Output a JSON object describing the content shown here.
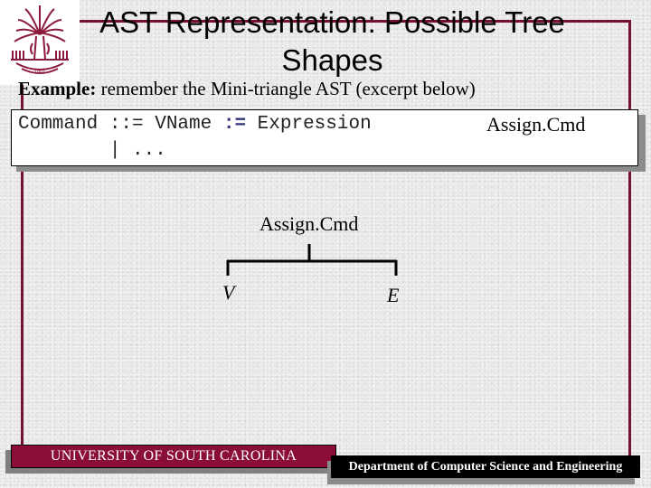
{
  "slide": {
    "title": "AST Representation: Possible Tree Shapes",
    "example_label": "Example:",
    "example_text": " remember the Mini-triangle AST (excerpt below)",
    "grammar": {
      "line1_lhs": "Command ::= VName ",
      "line1_op": ":=",
      "line1_rhs": " Expression",
      "line2": "        | ...",
      "node_label": "Assign.Cmd"
    },
    "tree": {
      "root": "Assign.Cmd",
      "children": [
        "V",
        "E"
      ]
    },
    "footer": {
      "university": "UNIVERSITY OF SOUTH CAROLINA",
      "department": "Department of Computer Science and Engineering"
    },
    "logo": {
      "icon": "usc-palmetto-logo-icon",
      "year": "1801"
    },
    "colors": {
      "maroon": "#7a0f35",
      "banner_maroon": "#8b0e3a",
      "operator_blue": "#33337a",
      "background": "#e9e9e7"
    }
  }
}
